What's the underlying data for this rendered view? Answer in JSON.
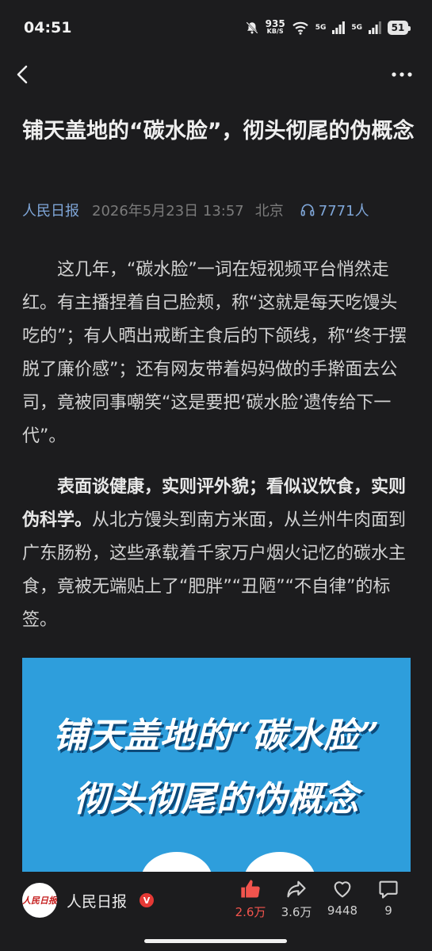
{
  "status_bar": {
    "time": "04:51",
    "net_speed_value": "935",
    "net_speed_unit": "KB/S",
    "signal_1_label": "5G",
    "signal_2_label": "5G",
    "battery": "51"
  },
  "article": {
    "title": "铺天盖地的“碳水脸”，彻头彻尾的伪概念",
    "source": "人民日报",
    "date": "2026年5月23日 13:57",
    "location": "北京",
    "listens": "7771人",
    "paragraph_1": "这几年，“碳水脸”一词在短视频平台悄然走红。有主播捏着自己脸颊，称“这就是每天吃馒头吃的”；有人晒出戒断主食后的下颌线，称“终于摆脱了廉价感”；还有网友带着妈妈做的手擀面去公司，竟被同事嘲笑“这是要把‘碳水脸’遗传给下一代”。",
    "paragraph_2_bold": "表面谈健康，实则评外貌；看似议饮食，实则伪科学。",
    "paragraph_2_rest": "从北方馒头到南方米面，从兰州牛肉面到广东肠粉，这些承载着千家万户烟火记忆的碳水主食，竟被无端贴上了“肥胖”“丑陋”“不自律”的标签。",
    "banner_line_1": "铺天盖地的“碳水脸”",
    "banner_line_2": "彻头彻尾的伪概念"
  },
  "bottom_bar": {
    "author_name": "人民日报",
    "avatar_text": "人民日报",
    "verified_mark": "V",
    "likes": "2.6万",
    "shares": "3.6万",
    "favorites": "9448",
    "comments": "9"
  },
  "colors": {
    "background": "#1c1c1e",
    "link_blue": "#7fa6d8",
    "like_red": "#f2544d",
    "banner_blue": "#2e9edc"
  }
}
